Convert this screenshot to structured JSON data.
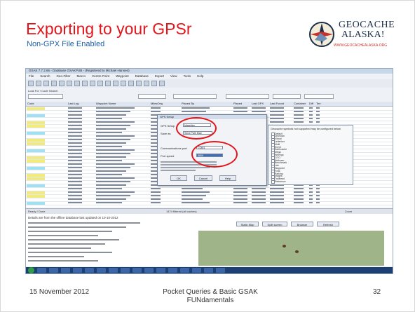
{
  "slide": {
    "title": "Exporting to your GPSr",
    "subtitle": "Non-GPX File Enabled"
  },
  "logo": {
    "line1": "GEOCACHE",
    "line2": "ALASKA!",
    "url": "WWW.GEOCACHEALASKA.ORG"
  },
  "app": {
    "window_title": "GSAK 7.7.2.66 - Database GSAKPUB - (Registered to Michael Hansen)",
    "menu": [
      "File",
      "Search",
      "Geo-Filter",
      "Macro",
      "Centre Point",
      "Waypoint",
      "Database",
      "Export",
      "View",
      "Tools",
      "Help"
    ],
    "columns": [
      "Code",
      "Last Log",
      "Waypoint Name",
      "MilesOrig",
      "Placed By",
      "Placed",
      "Last GPX",
      "Last Found",
      "Container",
      "Diff",
      "Terr"
    ],
    "status_left": "Ready / Done",
    "status_mid": "1474 filtered (all caches)",
    "status_right": "Zoom",
    "desc_header": "Details are from the offline database last updated on 10-10-2012",
    "buttons": [
      "Static Map",
      "Split screen",
      "Browser",
      "Refresh"
    ]
  },
  "dialog": {
    "title": "GPS Setup",
    "gps_setup_label": "GPS Setup",
    "gps_setup_value": "Magellan",
    "save_as_label": "Save as",
    "save_as_value": "Send Path Map",
    "comm_label": "Communications port",
    "comm_value": "COM1",
    "port_speed_label": "Port speed",
    "port_speed_value": "9600",
    "ok": "OK",
    "cancel": "Cancel",
    "help": "Help"
  },
  "panel": {
    "header": "Geocache symbols not supported may be configured below",
    "items": [
      "Default",
      "Unknown",
      "Virtual",
      "Letterbox",
      "Multi",
      "Event",
      "Earthcache",
      "Mega",
      "Wherigo",
      "CITO",
      "Webcam",
      "Benchmark",
      "Lab",
      "Waypoint",
      "Final",
      "Parking",
      "Stages",
      "Trailhead",
      "Reference"
    ]
  },
  "footer": {
    "date": "15 November  2012",
    "title": "Pocket Queries & Basic GSAK FUNdamentals",
    "page": "32"
  }
}
